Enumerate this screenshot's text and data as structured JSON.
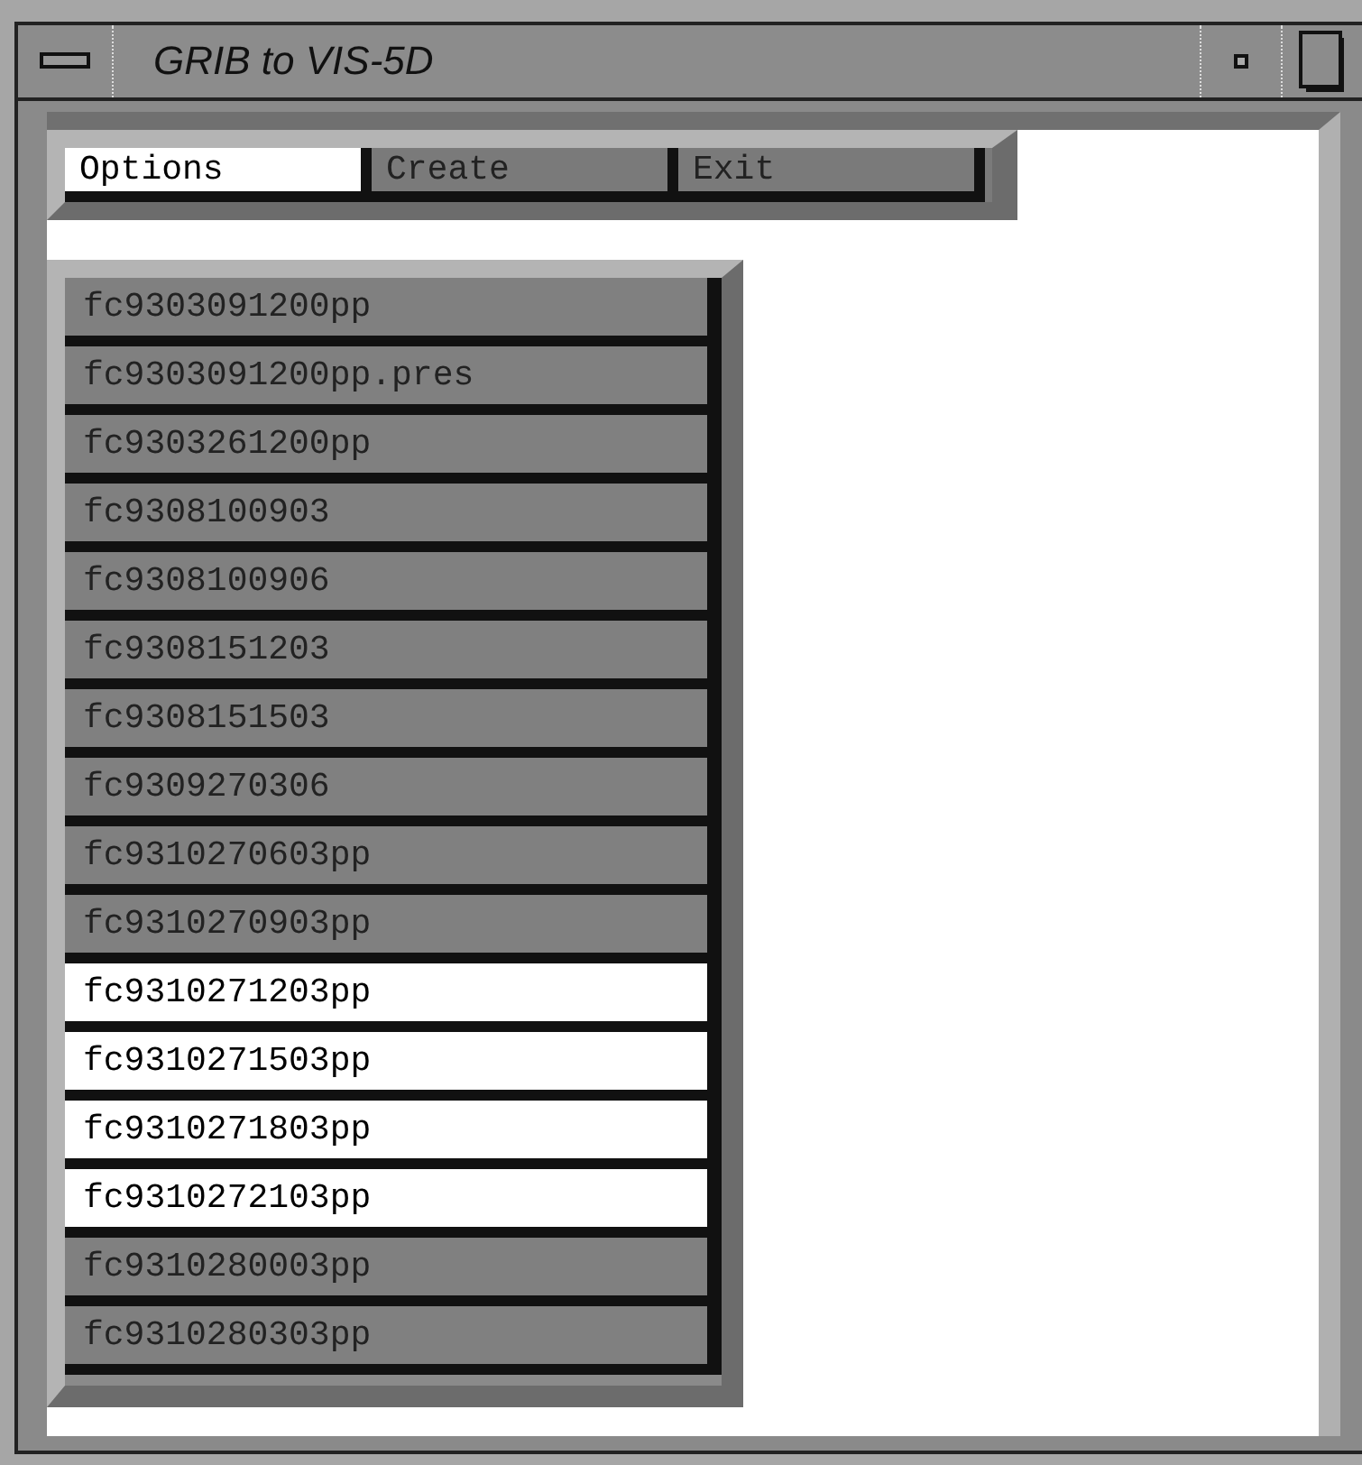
{
  "window": {
    "title": "GRIB to VIS-5D"
  },
  "menu": [
    {
      "label": "Options",
      "selected": true
    },
    {
      "label": "Create",
      "selected": false
    },
    {
      "label": "Exit",
      "selected": false
    }
  ],
  "files": [
    {
      "name": "fc9303091200pp",
      "selected": false
    },
    {
      "name": "fc9303091200pp.pres",
      "selected": false
    },
    {
      "name": "fc9303261200pp",
      "selected": false
    },
    {
      "name": "fc9308100903",
      "selected": false
    },
    {
      "name": "fc9308100906",
      "selected": false
    },
    {
      "name": "fc9308151203",
      "selected": false
    },
    {
      "name": "fc9308151503",
      "selected": false
    },
    {
      "name": "fc9309270306",
      "selected": false
    },
    {
      "name": "fc9310270603pp",
      "selected": false
    },
    {
      "name": "fc9310270903pp",
      "selected": false
    },
    {
      "name": "fc9310271203pp",
      "selected": true
    },
    {
      "name": "fc9310271503pp",
      "selected": true
    },
    {
      "name": "fc9310271803pp",
      "selected": true
    },
    {
      "name": "fc9310272103pp",
      "selected": true
    },
    {
      "name": "fc9310280003pp",
      "selected": false
    },
    {
      "name": "fc9310280303pp",
      "selected": false
    }
  ]
}
